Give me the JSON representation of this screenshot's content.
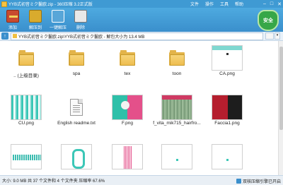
{
  "window": {
    "title": "YYB式初音ミク鬣欧.zip - 360压缩 3.2正式版",
    "menu": [
      "文件",
      "操作",
      "工具",
      "帮助"
    ]
  },
  "toolbar": {
    "buttons": [
      {
        "label": "添加",
        "icon": "add-icon"
      },
      {
        "label": "解压到",
        "icon": "extract-icon"
      },
      {
        "label": "一键解压",
        "icon": "one-click-extract-icon"
      },
      {
        "label": "删除",
        "icon": "delete-icon"
      }
    ],
    "security_badge": "安全"
  },
  "address": {
    "path": "YYB式初音ミク鬣欧.zip\\YYB式初音ミク鬣欧 - 解包大小为 13.4 MB"
  },
  "files": [
    {
      "name": ".. (上级目录)",
      "kind": "folder"
    },
    {
      "name": "spa",
      "kind": "folder"
    },
    {
      "name": "tex",
      "kind": "folder"
    },
    {
      "name": "toon",
      "kind": "folder"
    },
    {
      "name": "CA.png",
      "kind": "image"
    },
    {
      "name": "CU.png",
      "kind": "image"
    },
    {
      "name": "English readme.txt",
      "kind": "text"
    },
    {
      "name": "F.png",
      "kind": "image"
    },
    {
      "name": "f_vita_mik715_hairfro...",
      "kind": "image"
    },
    {
      "name": "Faccia1.png",
      "kind": "image"
    },
    {
      "name": "",
      "kind": "image"
    },
    {
      "name": "",
      "kind": "image"
    },
    {
      "name": "",
      "kind": "image"
    },
    {
      "name": "",
      "kind": "image"
    },
    {
      "name": "",
      "kind": "image"
    }
  ],
  "status": {
    "left": "大小: 9.0 MB 共 37 个文件和 4 个文件夹 压缩率 67.6%",
    "right": "双核压缩引擎已开启"
  },
  "colors": {
    "titlebar": "#3f9ad3",
    "toolbar": "#4eaae0",
    "security_badge": "#37a748"
  }
}
